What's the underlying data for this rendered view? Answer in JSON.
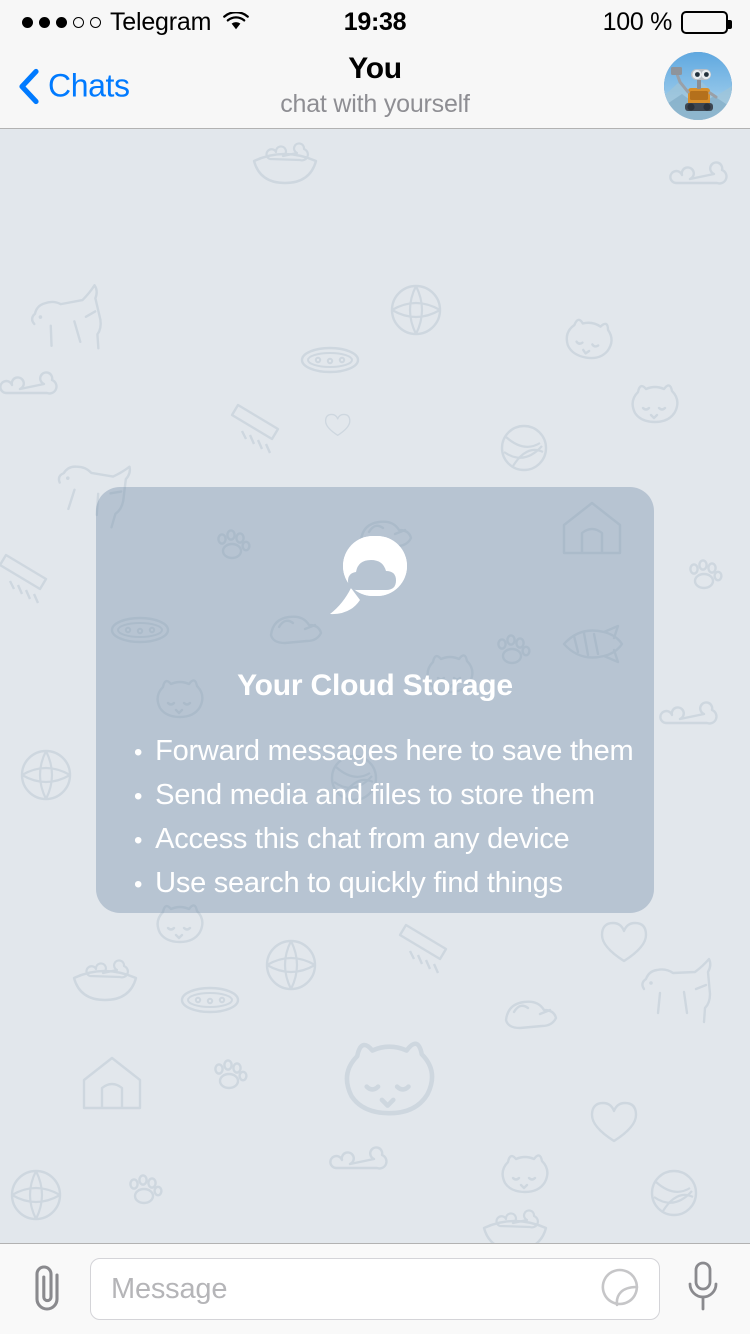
{
  "status_bar": {
    "signal_dots_filled": 3,
    "signal_dots_total": 5,
    "carrier": "Telegram",
    "wifi_icon": "wifi-icon",
    "time": "19:38",
    "battery_percent": "100 %",
    "battery_level": 100
  },
  "nav_bar": {
    "back_icon": "chevron-left-icon",
    "back_label": "Chats",
    "title": "You",
    "subtitle": "chat with yourself",
    "avatar_alt": "wall-e-avatar"
  },
  "chat": {
    "wallpaper": "pets-doodle-pattern",
    "card": {
      "icon": "cloud-speech-bubble-icon",
      "title": "Your Cloud Storage",
      "bullet_char": "•",
      "items": [
        "Forward messages here to save them",
        "Send media and files to store them",
        "Access this chat from any device",
        "Use search to quickly find things"
      ]
    }
  },
  "input_bar": {
    "attach_icon": "paperclip-icon",
    "placeholder": "Message",
    "value": "",
    "sticker_icon": "sticker-icon",
    "mic_icon": "microphone-icon"
  },
  "colors": {
    "accent_blue": "#007aff",
    "nav_background": "#f7f7f7",
    "chat_background": "#e2e7ec",
    "card_overlay": "rgba(125,148,175,0.42)",
    "subtitle_gray": "#8e8e93",
    "card_text": "#ffffff"
  }
}
